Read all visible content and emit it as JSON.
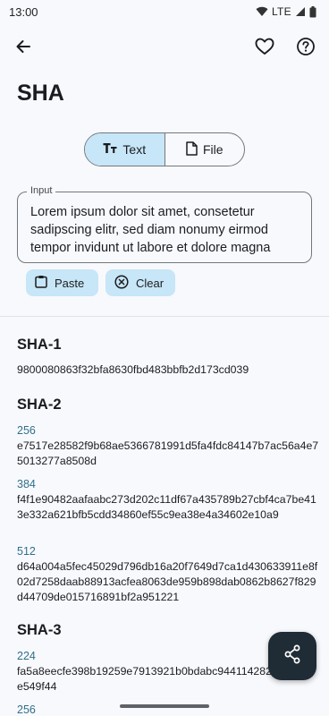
{
  "status": {
    "time": "13:00",
    "network": "LTE"
  },
  "page": {
    "title": "SHA"
  },
  "mode_toggle": {
    "text_label": "Text",
    "file_label": "File",
    "selected": "Text"
  },
  "input": {
    "label": "Input",
    "value": "Lorem ipsum dolor sit amet, consetetur sadipscing elitr, sed diam nonumy eirmod tempor invidunt ut labore et dolore magna"
  },
  "actions": {
    "paste_label": "Paste",
    "clear_label": "Clear"
  },
  "results": {
    "sha1": {
      "title": "SHA-1",
      "hash": "9800080863f32bfa8630fbd483bbfb2d173cd039"
    },
    "sha2": {
      "title": "SHA-2",
      "items": [
        {
          "bits": "256",
          "hash": "e7517e28582f9b68ae5366781991d5fa4fdc84147b7ac56a4e75013277a8508d"
        },
        {
          "bits": "384",
          "hash": "f4f1e90482aafaabc273d202c11df67a435789b27cbf4ca7be413e332a621bfb5cdd34860ef55c9ea38e4a34602e10a9"
        },
        {
          "bits": "512",
          "hash": "d64a004a5fec45029d796db16a20f7649d7ca1d430633911e8f02d7258daab88913acfea8063de959b898dab0862b8627f829d44709de015716891bf2a951221"
        }
      ]
    },
    "sha3": {
      "title": "SHA-3",
      "items": [
        {
          "bits": "224",
          "hash": "fa5a8eecfe398b19259e7913921b0bdabc944114282e549f44"
        },
        {
          "bits": "256",
          "hash": ""
        }
      ]
    }
  },
  "colors": {
    "accent_container": "#c7e6f7",
    "fab": "#1f2b35",
    "label_teal": "#31708a"
  }
}
